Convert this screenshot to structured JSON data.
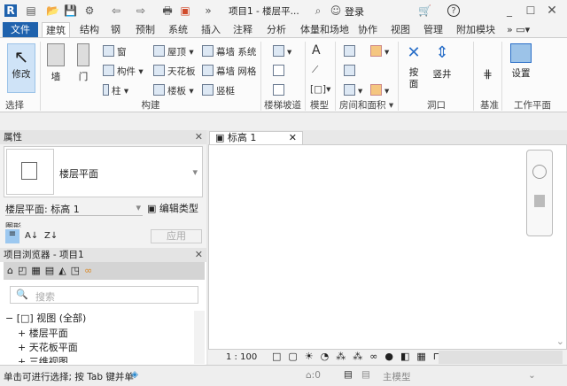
{
  "title_bar": {
    "app_badge": "R",
    "title": "项目1 - 楼层平...",
    "login": "登录",
    "help": "?"
  },
  "tabs": [
    "文件",
    "建筑",
    "结构",
    "钢",
    "预制",
    "系统",
    "插入",
    "注释",
    "分析",
    "体量和场地",
    "协作",
    "视图",
    "管理",
    "附加模块"
  ],
  "active_tab": "建筑",
  "ribbon": {
    "modify": "修改",
    "select_panel": "选择",
    "wall": "墙",
    "door": "门",
    "window": "窗",
    "component": "构件",
    "column": "柱",
    "roof": "屋顶",
    "ceiling": "天花板",
    "floor": "楼板",
    "curtain_system": "幕墙 系统",
    "curtain_grid": "幕墙 网格",
    "mullion": "竖梃",
    "build_panel": "构建",
    "stair_panel": "楼梯坡道",
    "model_panel": "模型",
    "room_panel": "房间和面积",
    "by_face": "按面",
    "shaft": "竖井",
    "opening_panel": "洞口",
    "datum_panel": "基准",
    "set": "设置",
    "workplane_panel": "工作平面"
  },
  "properties": {
    "title": "属性",
    "type_name": "楼层平面",
    "instance": "楼层平面: 标高 1",
    "edit_type": "编辑类型",
    "group": "图形",
    "apply": "应用"
  },
  "browser": {
    "title": "项目浏览器 - 项目1",
    "search_placeholder": "搜索",
    "root": "视图 (全部)",
    "items": [
      "楼层平面",
      "天花板平面",
      "三维视图"
    ]
  },
  "view": {
    "tab": "标高 1",
    "scale": "1 : 100"
  },
  "status": {
    "message": "单击可进行选择; 按 Tab 键并单",
    "selection_count": ":0",
    "model": "主模型"
  }
}
